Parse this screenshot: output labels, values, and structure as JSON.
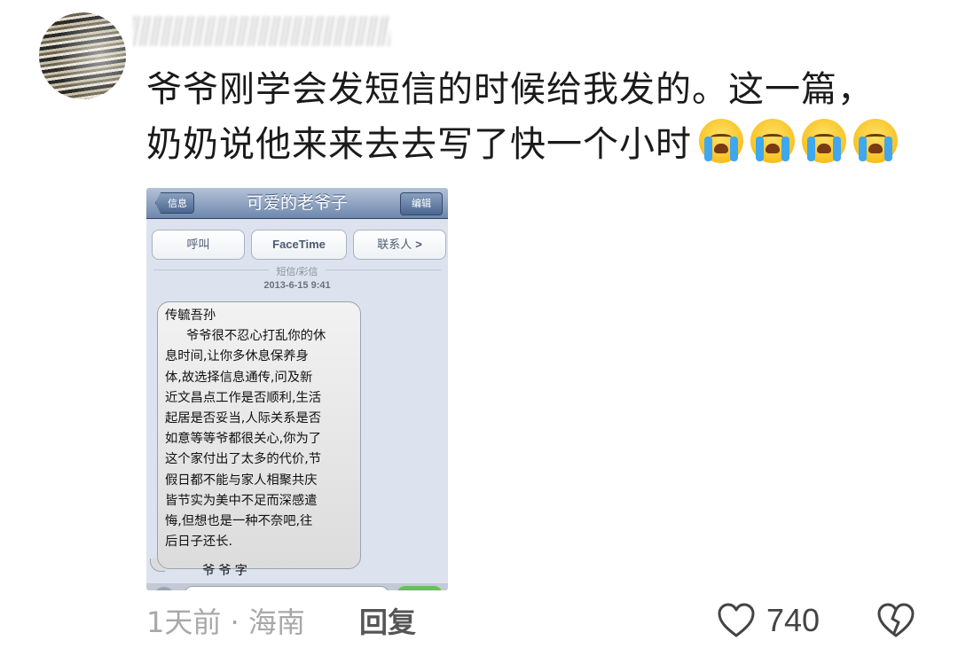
{
  "comment": {
    "line1": "爷爷刚学会发短信的时候给我发的。这一篇，",
    "line2": "奶奶说他来来去去写了快一个小时",
    "emoji_count_icons": [
      "crying-face-icon",
      "crying-face-icon",
      "crying-face-icon",
      "crying-face-icon"
    ]
  },
  "phone": {
    "back_label": "信息",
    "title": "可爱的老爷子",
    "edit_label": "编辑",
    "actions": {
      "call": "呼叫",
      "facetime": "FaceTime",
      "contacts": "联系人"
    },
    "sms_label": "短信/彩信",
    "timestamp": "2013-6-15 9:41",
    "message_lines": [
      "传毓吾孙",
      "爷爷很不忍心打乱你的休",
      "息时间,让你多休息保养身",
      "体,故选择信息通传,问及新",
      "近文昌点工作是否顺利,生活",
      "起居是否妥当,人际关系是否",
      "如意等等爷都很关心,你为了",
      "这个家付出了太多的代价,节",
      "假日都不能与家人相聚共庆",
      "皆节实为美中不足而深感遣",
      "悔,但想也是一种不奈吧,往",
      "后日子还长."
    ],
    "signature": "爷爷字"
  },
  "footer": {
    "time_location": "1天前 · 海南",
    "reply_label": "回复",
    "like_count": "740"
  },
  "colors": {
    "navbar": "#6e87ab",
    "bubble": "#e8e8e8",
    "text": "#1a1a1a",
    "meta": "#a8a8a8"
  }
}
